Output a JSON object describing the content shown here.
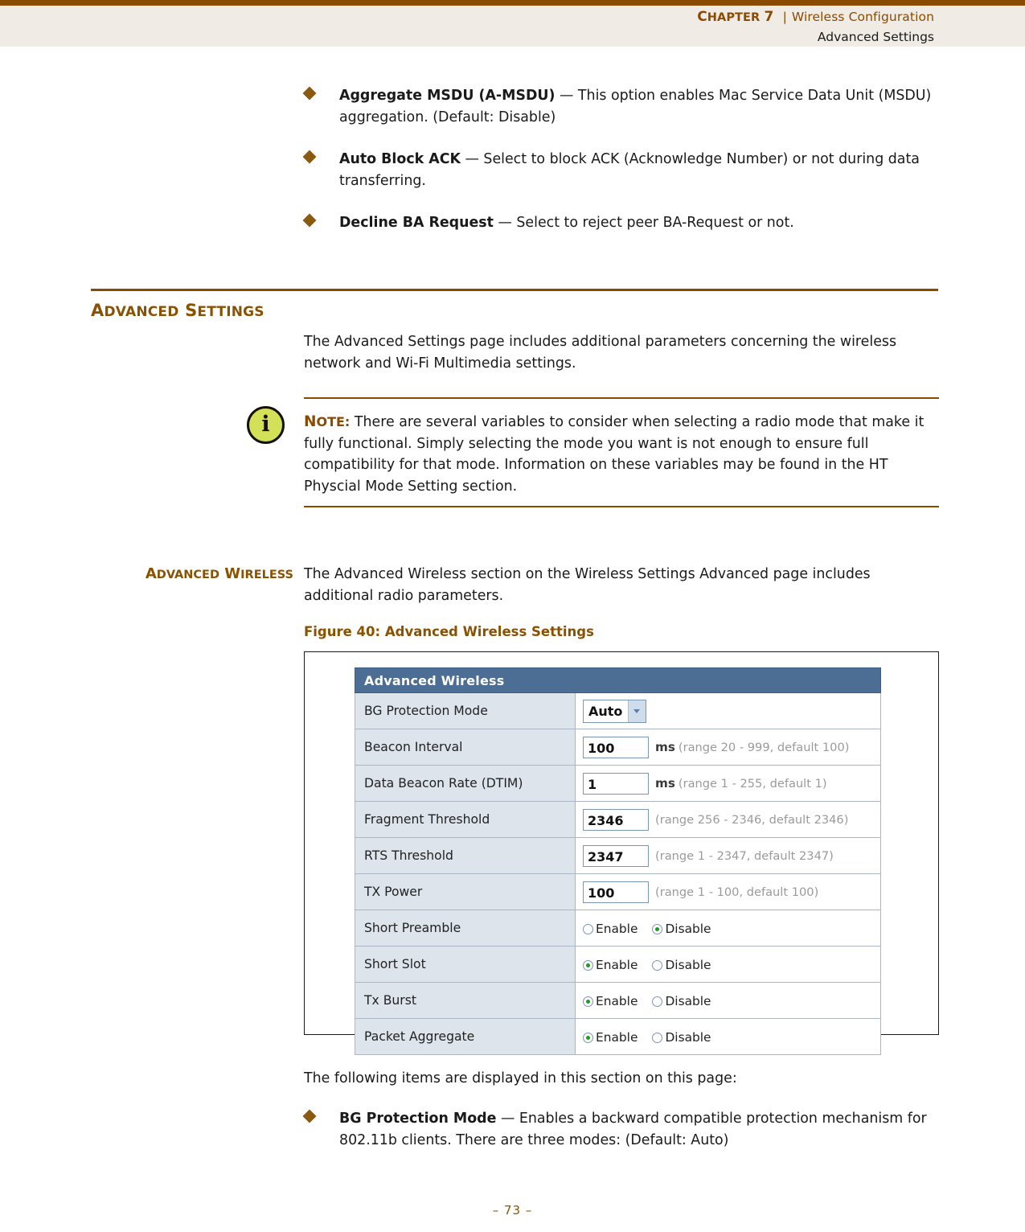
{
  "header": {
    "chapter_label": "Chapter 7",
    "separator": "|",
    "chapter_title": "Wireless Configuration",
    "subtitle": "Advanced Settings"
  },
  "top_bullets": [
    {
      "term": "Aggregate MSDU (A-MSDU)",
      "description": " — This option enables Mac Service Data Unit (MSDU) aggregation. (Default: Disable)"
    },
    {
      "term": "Auto Block ACK",
      "description": " — Select to block ACK (Acknowledge Number) or not during data transferring."
    },
    {
      "term": "Decline BA Request",
      "description": " — Select to reject peer BA-Request or not."
    }
  ],
  "section": {
    "heading": "Advanced Settings",
    "intro_paragraph": "The Advanced Settings page includes additional parameters concerning the wireless network and Wi-Fi Multimedia settings."
  },
  "note": {
    "icon_name": "info-icon",
    "icon_glyph": "i",
    "label": "Note:",
    "text": " There are several variables to consider when selecting a radio mode that make it fully functional. Simply selecting the mode you want is not enough to ensure full compatibility for that mode. Information on these variables may be found in the HT Physcial Mode Setting section."
  },
  "advanced_wireless": {
    "margin_heading": "Advanced Wireless",
    "paragraph": "The Advanced Wireless section on the Wireless Settings Advanced page includes additional radio parameters.",
    "figure_caption": "Figure 40:  Advanced Wireless Settings"
  },
  "app_screenshot": {
    "panel_title": "Advanced Wireless",
    "rows": [
      {
        "label": "BG Protection Mode",
        "control": "select",
        "value": "Auto"
      },
      {
        "label": "Beacon Interval",
        "control": "text",
        "value": "100",
        "unit": "ms",
        "range": "(range 20 - 999, default 100)"
      },
      {
        "label": "Data Beacon Rate (DTIM)",
        "control": "text",
        "value": "1",
        "unit": "ms",
        "range": "(range 1 - 255, default 1)"
      },
      {
        "label": "Fragment Threshold",
        "control": "text",
        "value": "2346",
        "unit": "",
        "range": "(range 256 - 2346, default 2346)"
      },
      {
        "label": "RTS Threshold",
        "control": "text",
        "value": "2347",
        "unit": "",
        "range": "(range 1 - 2347, default 2347)"
      },
      {
        "label": "TX Power",
        "control": "text",
        "value": "100",
        "unit": "",
        "range": "(range 1 - 100, default 100)"
      },
      {
        "label": "Short Preamble",
        "control": "radio",
        "options": [
          "Enable",
          "Disable"
        ],
        "selected": "Disable"
      },
      {
        "label": "Short Slot",
        "control": "radio",
        "options": [
          "Enable",
          "Disable"
        ],
        "selected": "Enable"
      },
      {
        "label": "Tx Burst",
        "control": "radio",
        "options": [
          "Enable",
          "Disable"
        ],
        "selected": "Enable"
      },
      {
        "label": "Packet Aggregate",
        "control": "radio",
        "options": [
          "Enable",
          "Disable"
        ],
        "selected": "Enable"
      }
    ]
  },
  "bottom": {
    "lead_in": "The following items are displayed in this section on this page:",
    "bullets": [
      {
        "term": "BG Protection Mode",
        "description": " — Enables a backward compatible protection mechanism for 802.11b clients. There are three modes: (Default: Auto)"
      }
    ]
  },
  "footer": {
    "page_number": "–  73  –"
  },
  "colors": {
    "accent_brown": "#8a4b00",
    "heading_brown": "#8a5200",
    "header_bg": "#f0ebe5",
    "panel_header_blue": "#4d6e94",
    "label_cell_blue": "#dde4ec",
    "note_icon_green": "#d2e158",
    "radio_on_green": "#18a018"
  }
}
